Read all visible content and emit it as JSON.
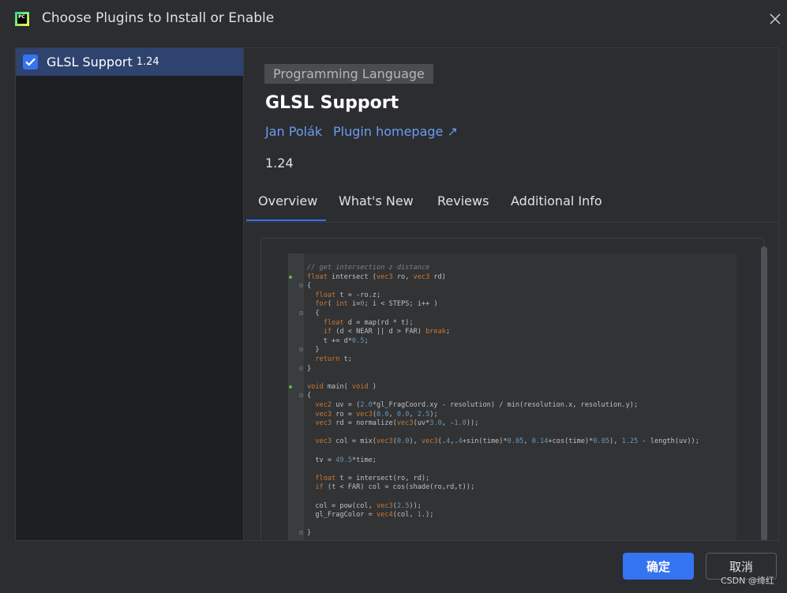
{
  "window": {
    "title": "Choose Plugins to Install or Enable",
    "logo_text": "PC"
  },
  "plugins": [
    {
      "name": "GLSL Support",
      "version": "1.24",
      "checked": true
    }
  ],
  "detail": {
    "category": "Programming Language",
    "title": "GLSL Support",
    "author": "Jan Polák",
    "homepage": "Plugin homepage ↗",
    "version": "1.24"
  },
  "tabs": [
    {
      "label": "Overview",
      "selected": true
    },
    {
      "label": "What's New",
      "selected": false
    },
    {
      "label": "Reviews",
      "selected": false
    },
    {
      "label": "Additional Info",
      "selected": false
    }
  ],
  "code_lines": [
    "// get intersection z distance",
    "float intersect (vec3 ro, vec3 rd)",
    "{",
    "  float t = -ro.z;",
    "  for( int i=0; i < STEPS; i++ )",
    "  {",
    "    float d = map(rd * t);",
    "    if (d < NEAR || d > FAR) break;",
    "    t += d*0.5;",
    "  }",
    "  return t;",
    "}",
    "",
    "void main( void )",
    "{",
    "  vec2 uv = (2.0*gl_FragCoord.xy - resolution) / min(resolution.x, resolution.y);",
    "  vec3 ro = vec3(0.0, 0.0, 2.5);",
    "  vec3 rd = normalize(vec3(uv*3.0, -1.0));",
    "",
    "  vec3 col = mix(vec3(0.0), vec3(.4,.4+sin(time)*0.05, 0.14+cos(time)*0.05), 1.25 - length(uv));",
    "",
    "  tv = 49.5*time;",
    "",
    "  float t = intersect(ro, rd);",
    "  if (t < FAR) col = cos(shade(ro,rd,t));",
    "",
    "  col = pow(col, vec3(2.5));",
    "  gl_FragColor = vec4(col, 1.);",
    "",
    "}"
  ],
  "buttons": {
    "ok": "确定",
    "cancel": "取消"
  },
  "watermark": "CSDN @绛红",
  "colors": {
    "accent": "#3574f0",
    "link": "#6c9cf3",
    "selection": "#2e436e"
  }
}
